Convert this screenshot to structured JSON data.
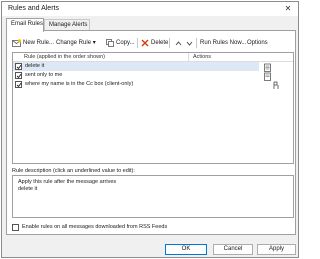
{
  "window": {
    "title": "Rules and Alerts",
    "close_glyph": "✕"
  },
  "tabs": [
    {
      "label": "Email Rules",
      "active": true
    },
    {
      "label": "Manage Alerts",
      "active": false
    }
  ],
  "toolbar": {
    "new_rule": "New Rule...",
    "change_rule": "Change Rule ▾",
    "copy": "Copy...",
    "delete": "Delete",
    "run_rules": "Run Rules Now...",
    "options": "Options"
  },
  "table": {
    "col_rule": "Rule (applied in the order shown)",
    "col_actions": "Actions",
    "rows": [
      {
        "label": "delete it",
        "checked": true,
        "selected": true
      },
      {
        "label": "sent only to me",
        "checked": true,
        "selected": false
      },
      {
        "label": "where my name is in the Cc box  (client-only)",
        "checked": true,
        "selected": false
      }
    ]
  },
  "description": {
    "label": "Rule description (click an underlined value to edit):",
    "lines": [
      "Apply this rule after the message arrives",
      "delete it"
    ]
  },
  "rss_option": {
    "label": "Enable rules on all messages downloaded from RSS Feeds",
    "checked": false
  },
  "buttons": {
    "ok": "OK",
    "cancel": "Cancel",
    "apply": "Apply"
  },
  "colors": {
    "selection": "#dce8f6",
    "accent": "#0078d7",
    "delete_red": "#d83b01"
  }
}
